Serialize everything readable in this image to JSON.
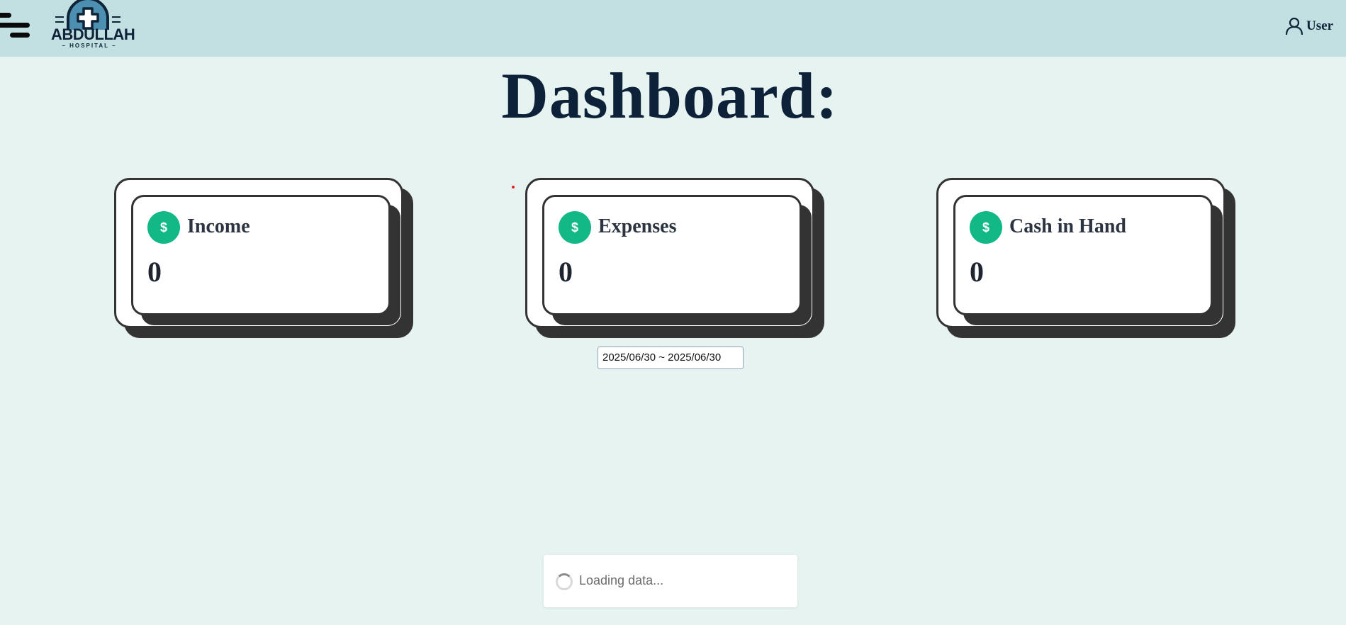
{
  "header": {
    "logo_main": "ABDULLAH",
    "logo_sub": "– HOSPITAL –",
    "user_label": "User",
    "menu_icon": "hamburger-menu-icon",
    "user_icon": "user-icon"
  },
  "page": {
    "title": "Dashboard:"
  },
  "cards": [
    {
      "title": "Income",
      "value": "0",
      "icon": "dollar-icon"
    },
    {
      "title": "Expenses",
      "value": "0",
      "icon": "dollar-icon"
    },
    {
      "title": "Cash in Hand",
      "value": "0",
      "icon": "dollar-icon"
    }
  ],
  "filters": {
    "date_range": "2025/06/30 ~ 2025/06/30"
  },
  "loading": {
    "text": "Loading data..."
  },
  "colors": {
    "accent": "#12b886",
    "topbar": "#c2dfe2",
    "background": "#e6f3f1",
    "title": "#0d2239"
  }
}
